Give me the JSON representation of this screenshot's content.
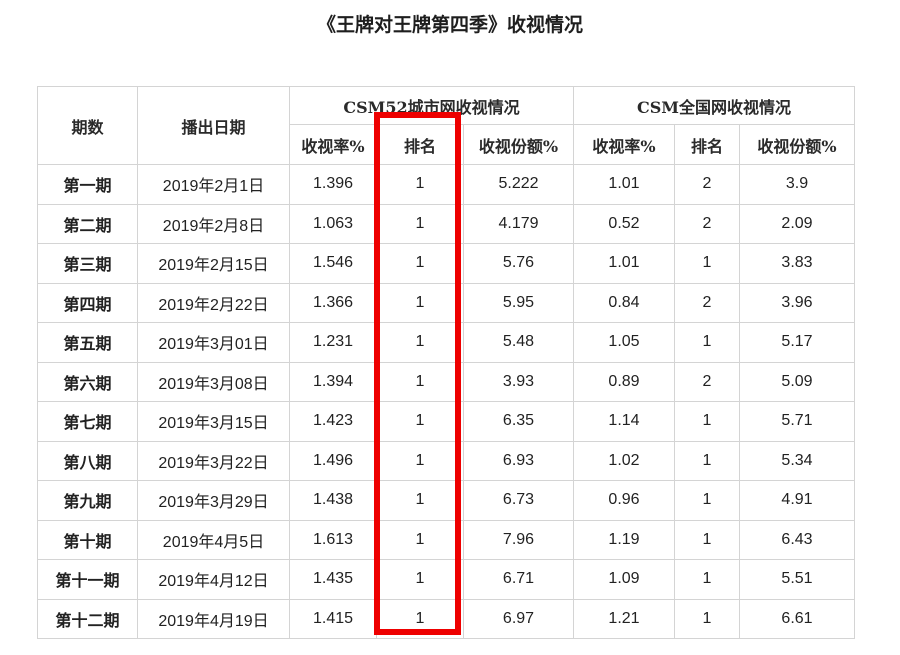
{
  "title": "《王牌对王牌第四季》收视情况",
  "headers": {
    "episode": "期数",
    "air_date": "播出日期",
    "csm52_group": "CSM52城市网收视情况",
    "national_group": "CSM全国网收视情况",
    "rating": "收视率%",
    "rank": "排名",
    "share": "收视份额%"
  },
  "rows": [
    {
      "episode": "第一期",
      "date": "2019年2月1日",
      "csm52_rating": "1.396",
      "csm52_rank": "1",
      "csm52_share": "5.222",
      "nat_rating": "1.01",
      "nat_rank": "2",
      "nat_share": "3.9"
    },
    {
      "episode": "第二期",
      "date": "2019年2月8日",
      "csm52_rating": "1.063",
      "csm52_rank": "1",
      "csm52_share": "4.179",
      "nat_rating": "0.52",
      "nat_rank": "2",
      "nat_share": "2.09"
    },
    {
      "episode": "第三期",
      "date": "2019年2月15日",
      "csm52_rating": "1.546",
      "csm52_rank": "1",
      "csm52_share": "5.76",
      "nat_rating": "1.01",
      "nat_rank": "1",
      "nat_share": "3.83"
    },
    {
      "episode": "第四期",
      "date": "2019年2月22日",
      "csm52_rating": "1.366",
      "csm52_rank": "1",
      "csm52_share": "5.95",
      "nat_rating": "0.84",
      "nat_rank": "2",
      "nat_share": "3.96"
    },
    {
      "episode": "第五期",
      "date": "2019年3月01日",
      "csm52_rating": "1.231",
      "csm52_rank": "1",
      "csm52_share": "5.48",
      "nat_rating": "1.05",
      "nat_rank": "1",
      "nat_share": "5.17"
    },
    {
      "episode": "第六期",
      "date": "2019年3月08日",
      "csm52_rating": "1.394",
      "csm52_rank": "1",
      "csm52_share": "3.93",
      "nat_rating": "0.89",
      "nat_rank": "2",
      "nat_share": "5.09"
    },
    {
      "episode": "第七期",
      "date": "2019年3月15日",
      "csm52_rating": "1.423",
      "csm52_rank": "1",
      "csm52_share": "6.35",
      "nat_rating": "1.14",
      "nat_rank": "1",
      "nat_share": "5.71"
    },
    {
      "episode": "第八期",
      "date": "2019年3月22日",
      "csm52_rating": "1.496",
      "csm52_rank": "1",
      "csm52_share": "6.93",
      "nat_rating": "1.02",
      "nat_rank": "1",
      "nat_share": "5.34"
    },
    {
      "episode": "第九期",
      "date": "2019年3月29日",
      "csm52_rating": "1.438",
      "csm52_rank": "1",
      "csm52_share": "6.73",
      "nat_rating": "0.96",
      "nat_rank": "1",
      "nat_share": "4.91"
    },
    {
      "episode": "第十期",
      "date": "2019年4月5日",
      "csm52_rating": "1.613",
      "csm52_rank": "1",
      "csm52_share": "7.96",
      "nat_rating": "1.19",
      "nat_rank": "1",
      "nat_share": "6.43"
    },
    {
      "episode": "第十一期",
      "date": "2019年4月12日",
      "csm52_rating": "1.435",
      "csm52_rank": "1",
      "csm52_share": "6.71",
      "nat_rating": "1.09",
      "nat_rank": "1",
      "nat_share": "5.51"
    },
    {
      "episode": "第十二期",
      "date": "2019年4月19日",
      "csm52_rating": "1.415",
      "csm52_rank": "1",
      "csm52_share": "6.97",
      "nat_rating": "1.21",
      "nat_rank": "1",
      "nat_share": "6.61"
    }
  ],
  "colors": {
    "highlight": "#ee0000",
    "border": "#d4d4d4"
  }
}
